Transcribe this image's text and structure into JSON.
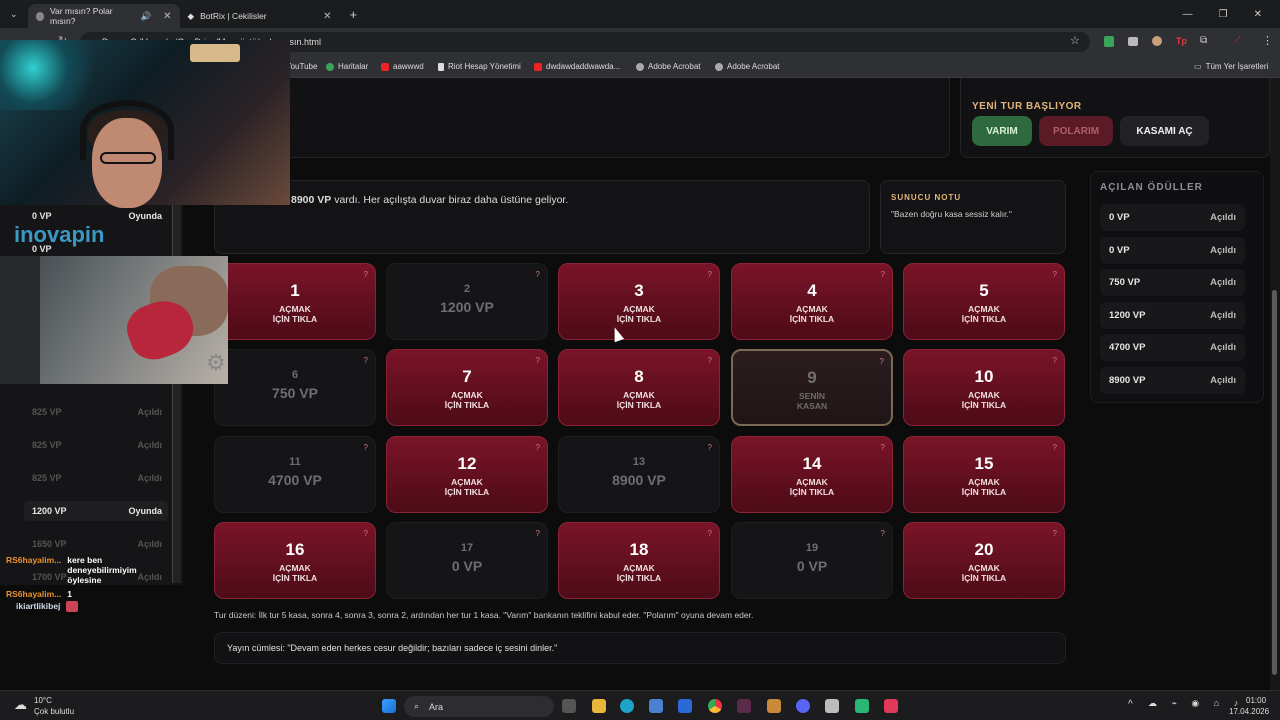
{
  "browser": {
    "tabs": [
      {
        "title": "Var mısın? Polar mısın?"
      },
      {
        "title": "BotRix | Cekilisler"
      }
    ],
    "url": "C:/Users/.../OneDrive/Masaüstü/polarmısın.html",
    "bookmarks": [
      "YouTube",
      "Haritalar",
      "aawwwd",
      "Riot Hesap Yönetimi",
      "dwdawdaddwawda...",
      "Adobe Acrobat",
      "Adobe Acrobat",
      "Tüm Yer İşaretleri"
    ],
    "page_label": "Deven"
  },
  "round": {
    "title": "YENİ TUR BAŞLIYOR",
    "buttons": [
      "VARIM",
      "POLARIM",
      "KASAMI AÇ"
    ]
  },
  "message": {
    "amount": "8900 VP",
    "text": " vardı. Her açılışta duvar biraz daha üstüne geliyor."
  },
  "host_note": {
    "title": "SUNUCU NOTU",
    "text": "\"Bazen doğru kasa sessiz kalır.\""
  },
  "cards": [
    {
      "n": "1",
      "state": "closed",
      "label": "AÇMAK İÇİN TIKLA"
    },
    {
      "n": "2",
      "state": "opened",
      "value": "1200 VP"
    },
    {
      "n": "3",
      "state": "closed",
      "label": "AÇMAK İÇİN TIKLA"
    },
    {
      "n": "4",
      "state": "closed",
      "label": "AÇMAK İÇİN TIKLA"
    },
    {
      "n": "5",
      "state": "closed",
      "label": "AÇMAK İÇİN TIKLA"
    },
    {
      "n": "6",
      "state": "opened",
      "value": "750 VP"
    },
    {
      "n": "7",
      "state": "closed",
      "label": "AÇMAK İÇİN TIKLA"
    },
    {
      "n": "8",
      "state": "closed",
      "label": "AÇMAK İÇİN TIKLA"
    },
    {
      "n": "9",
      "state": "mine",
      "label": "SENİN KASAN"
    },
    {
      "n": "10",
      "state": "closed",
      "label": "AÇMAK İÇİN TIKLA"
    },
    {
      "n": "11",
      "state": "opened",
      "value": "4700 VP"
    },
    {
      "n": "12",
      "state": "closed",
      "label": "AÇMAK İÇİN TIKLA"
    },
    {
      "n": "13",
      "state": "opened",
      "value": "8900 VP"
    },
    {
      "n": "14",
      "state": "closed",
      "label": "AÇMAK İÇİN TIKLA"
    },
    {
      "n": "15",
      "state": "closed",
      "label": "AÇMAK İÇİN TIKLA"
    },
    {
      "n": "16",
      "state": "closed",
      "label": "AÇMAK İÇİN TIKLA"
    },
    {
      "n": "17",
      "state": "opened",
      "value": "0 VP"
    },
    {
      "n": "18",
      "state": "closed",
      "label": "AÇMAK İÇİN TIKLA"
    },
    {
      "n": "19",
      "state": "opened",
      "value": "0 VP"
    },
    {
      "n": "20",
      "state": "closed",
      "label": "AÇMAK İÇİN TIKLA"
    }
  ],
  "rules": "Tur düzeni: İlk tur 5 kasa, sonra 4, sonra 3, sonra 2, ardından her tur 1 kasa. \"Varım\" bankanın teklifini kabul eder. \"Polarım\" oyuna devam eder.",
  "quote": "Yayın cümlesi: \"Devam eden herkes cesur değildir; bazıları sadece iç sesini dinler.\"",
  "rewards": {
    "title": "AÇILAN ÖDÜLLER",
    "items": [
      {
        "value": "0 VP",
        "status": "Açıldı"
      },
      {
        "value": "0 VP",
        "status": "Açıldı"
      },
      {
        "value": "750 VP",
        "status": "Açıldı"
      },
      {
        "value": "1200 VP",
        "status": "Açıldı"
      },
      {
        "value": "4700 VP",
        "status": "Açıldı"
      },
      {
        "value": "8900 VP",
        "status": "Açıldı"
      }
    ]
  },
  "left_list": [
    {
      "value": "0 VP",
      "status": "Oyunda"
    },
    {
      "value": "0 VP",
      "status": ""
    },
    {
      "value": "825 VP",
      "status": "Açıldı"
    },
    {
      "value": "825 VP",
      "status": "Açıldı"
    },
    {
      "value": "825 VP",
      "status": "Açıldı"
    },
    {
      "value": "1200 VP",
      "status": "Oyunda"
    },
    {
      "value": "1650 VP",
      "status": "Açıldı"
    },
    {
      "value": "1700 VP",
      "status": "Açıldı"
    }
  ],
  "chat": [
    {
      "user": "RS6hayalim...",
      "msg": "kere ben deneyebilirmiyim öylesine"
    },
    {
      "user": "RS6hayalim...",
      "msg": "1"
    },
    {
      "user": "ikiartlikibej",
      "msg": ""
    }
  ],
  "overlay_brand": "inovapin",
  "taskbar": {
    "weather_temp": "10°C",
    "weather_desc": "Çok bulutlu",
    "search": "Ara",
    "time": "01:00",
    "date": "17.04.2026"
  }
}
